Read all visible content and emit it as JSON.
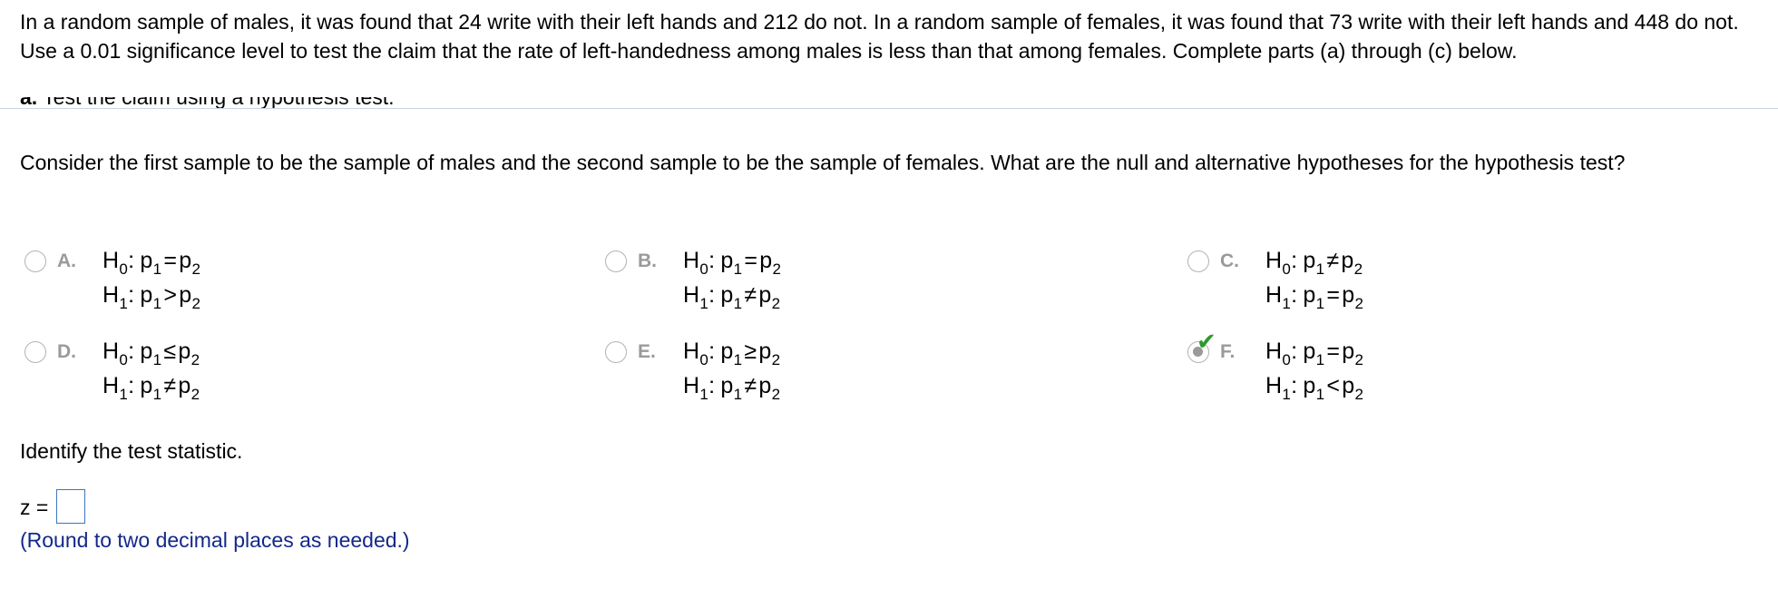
{
  "problem": {
    "text": "In a random sample of males, it was found that 24 write with their left hands and 212 do not. In a random sample of females, it was found that 73 write with their left hands and 448 do not. Use a 0.01 significance level to test the claim that the rate of left-handedness among males is less than that among females. Complete parts (a) through (c) below."
  },
  "part_a": {
    "label": "a.",
    "text": "Test the claim using a hypothesis test."
  },
  "question": {
    "text": "Consider the first sample to be the sample of males and the second sample to be the sample of females. What are the null and alternative hypotheses for the hypothesis test?"
  },
  "choices": [
    {
      "letter": "A.",
      "h0_label": "H",
      "h0_sub": "0",
      "h0_colon": ":",
      "h0_lhs": "p",
      "h0_lhs_sub": "1",
      "h0_rel": "=",
      "h0_rhs": "p",
      "h0_rhs_sub": "2",
      "h1_label": "H",
      "h1_sub": "1",
      "h1_colon": ":",
      "h1_lhs": "p",
      "h1_lhs_sub": "1",
      "h1_rel": ">",
      "h1_rhs": "p",
      "h1_rhs_sub": "2",
      "selected": false
    },
    {
      "letter": "B.",
      "h0_label": "H",
      "h0_sub": "0",
      "h0_colon": ":",
      "h0_lhs": "p",
      "h0_lhs_sub": "1",
      "h0_rel": "=",
      "h0_rhs": "p",
      "h0_rhs_sub": "2",
      "h1_label": "H",
      "h1_sub": "1",
      "h1_colon": ":",
      "h1_lhs": "p",
      "h1_lhs_sub": "1",
      "h1_rel": "≠",
      "h1_rhs": "p",
      "h1_rhs_sub": "2",
      "selected": false
    },
    {
      "letter": "C.",
      "h0_label": "H",
      "h0_sub": "0",
      "h0_colon": ":",
      "h0_lhs": "p",
      "h0_lhs_sub": "1",
      "h0_rel": "≠",
      "h0_rhs": "p",
      "h0_rhs_sub": "2",
      "h1_label": "H",
      "h1_sub": "1",
      "h1_colon": ":",
      "h1_lhs": "p",
      "h1_lhs_sub": "1",
      "h1_rel": "=",
      "h1_rhs": "p",
      "h1_rhs_sub": "2",
      "selected": false
    },
    {
      "letter": "D.",
      "h0_label": "H",
      "h0_sub": "0",
      "h0_colon": ":",
      "h0_lhs": "p",
      "h0_lhs_sub": "1",
      "h0_rel": "≤",
      "h0_rhs": "p",
      "h0_rhs_sub": "2",
      "h1_label": "H",
      "h1_sub": "1",
      "h1_colon": ":",
      "h1_lhs": "p",
      "h1_lhs_sub": "1",
      "h1_rel": "≠",
      "h1_rhs": "p",
      "h1_rhs_sub": "2",
      "selected": false
    },
    {
      "letter": "E.",
      "h0_label": "H",
      "h0_sub": "0",
      "h0_colon": ":",
      "h0_lhs": "p",
      "h0_lhs_sub": "1",
      "h0_rel": "≥",
      "h0_rhs": "p",
      "h0_rhs_sub": "2",
      "h1_label": "H",
      "h1_sub": "1",
      "h1_colon": ":",
      "h1_lhs": "p",
      "h1_lhs_sub": "1",
      "h1_rel": "≠",
      "h1_rhs": "p",
      "h1_rhs_sub": "2",
      "selected": false
    },
    {
      "letter": "F.",
      "h0_label": "H",
      "h0_sub": "0",
      "h0_colon": ":",
      "h0_lhs": "p",
      "h0_lhs_sub": "1",
      "h0_rel": "=",
      "h0_rhs": "p",
      "h0_rhs_sub": "2",
      "h1_label": "H",
      "h1_sub": "1",
      "h1_colon": ":",
      "h1_lhs": "p",
      "h1_lhs_sub": "1",
      "h1_rel": "<",
      "h1_rhs": "p",
      "h1_rhs_sub": "2",
      "selected": true
    }
  ],
  "correct_mark": "✔",
  "identify": {
    "text": "Identify the test statistic."
  },
  "z_input": {
    "label": "z =",
    "value": ""
  },
  "round_note": {
    "text": "(Round to two decimal places as needed.)"
  },
  "colors": {
    "text": "#000000",
    "note_blue": "#13288a",
    "input_border": "#3b76c2",
    "check_green": "#2c9a2c",
    "letter_gray": "#9a9a9a"
  }
}
